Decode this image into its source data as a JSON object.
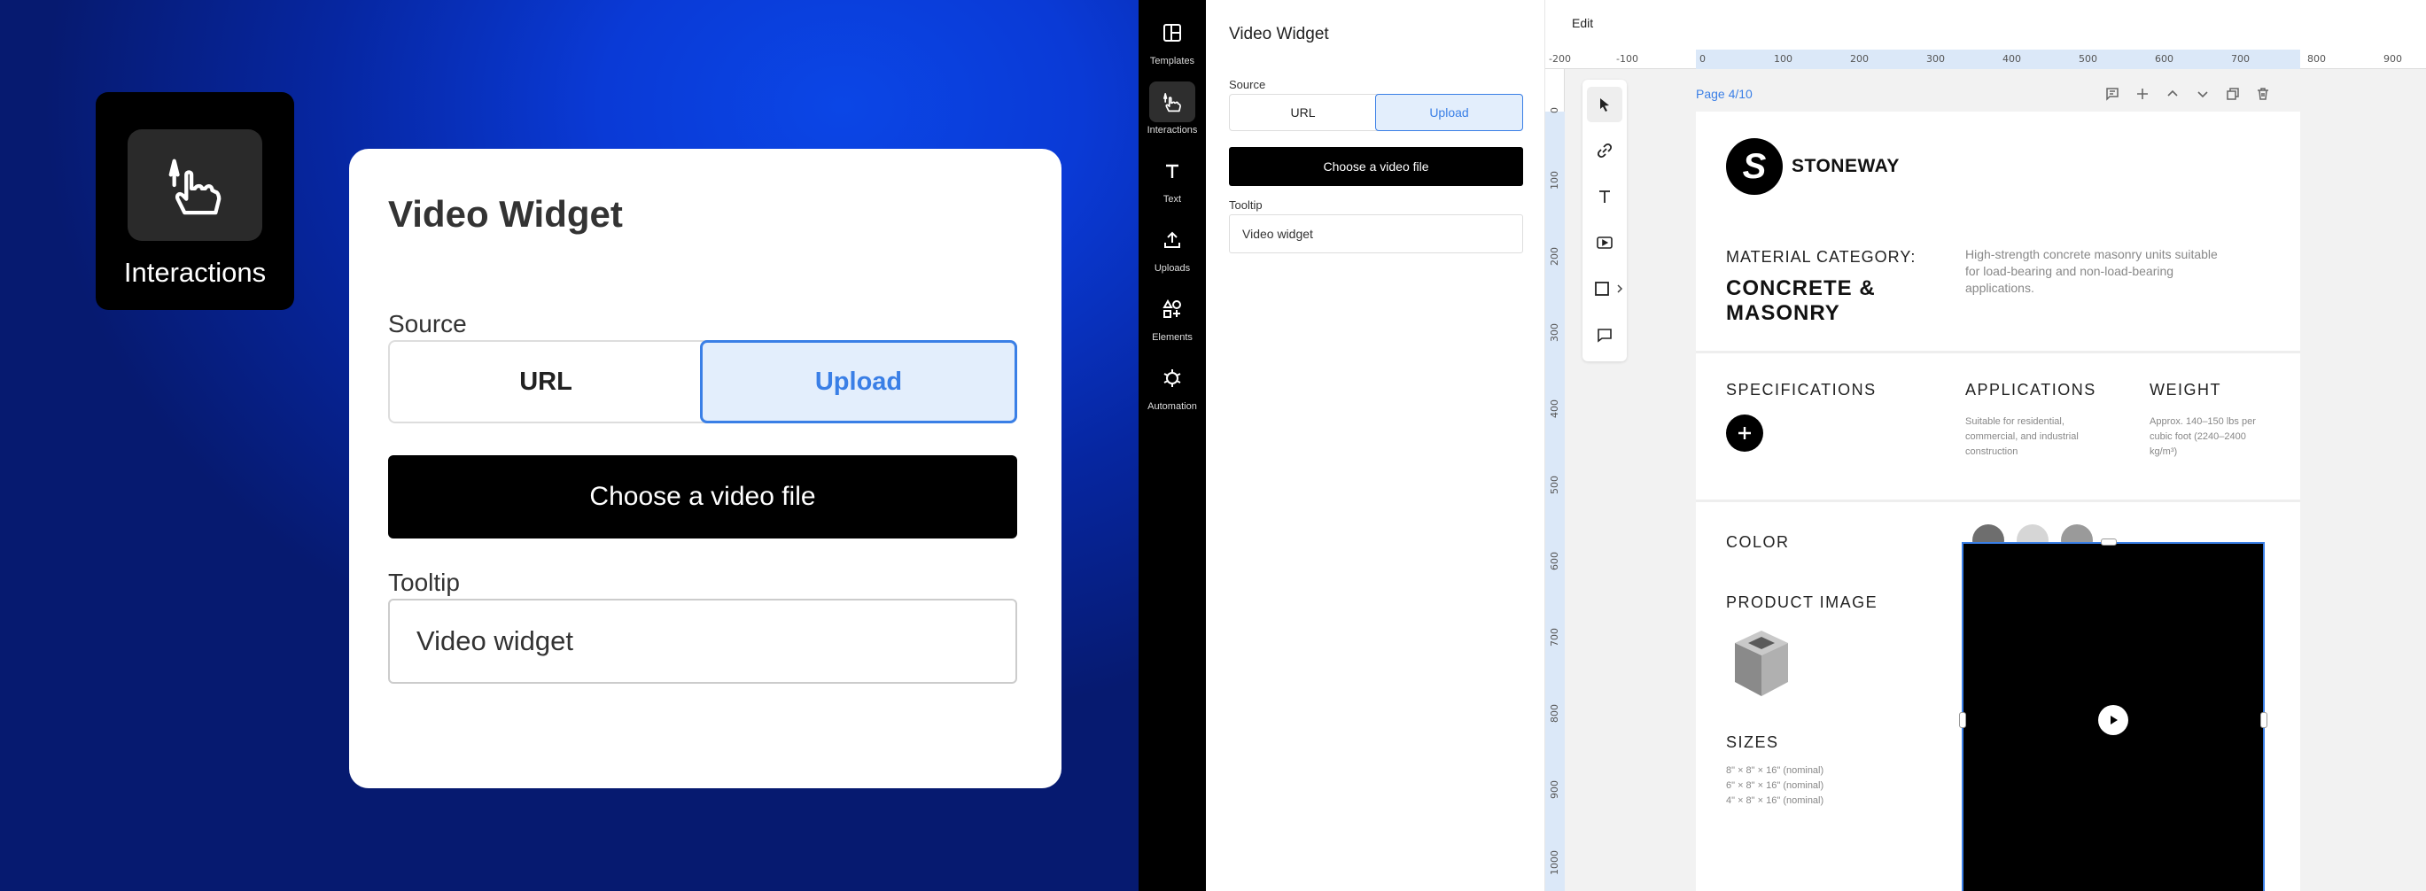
{
  "promo": {
    "badge_label": "Interactions",
    "card": {
      "title": "Video Widget",
      "source_label": "Source",
      "source_options": [
        "URL",
        "Upload"
      ],
      "source_selected": "Upload",
      "choose_button": "Choose a video file",
      "tooltip_label": "Tooltip",
      "tooltip_value": "Video widget"
    }
  },
  "sidebar": {
    "items": [
      {
        "label": "Templates",
        "icon": "templates-icon"
      },
      {
        "label": "Interactions",
        "icon": "interactions-icon",
        "active": true
      },
      {
        "label": "Text",
        "icon": "text-icon"
      },
      {
        "label": "Uploads",
        "icon": "upload-icon"
      },
      {
        "label": "Elements",
        "icon": "elements-icon"
      },
      {
        "label": "Automation",
        "icon": "automation-icon"
      }
    ]
  },
  "props": {
    "title": "Video Widget",
    "source_label": "Source",
    "source_options": [
      "URL",
      "Upload"
    ],
    "source_selected": "Upload",
    "choose_button": "Choose a video file",
    "tooltip_label": "Tooltip",
    "tooltip_value": "Video widget"
  },
  "canvas": {
    "topbar_edit": "Edit",
    "ruler_h": [
      "-200",
      "-100",
      "0",
      "100",
      "200",
      "300",
      "400",
      "500",
      "600",
      "700",
      "800",
      "900"
    ],
    "ruler_v": [
      "0",
      "100",
      "200",
      "300",
      "400",
      "500",
      "600",
      "700",
      "800",
      "900",
      "1000"
    ],
    "page_label": "Page 4/10",
    "doc": {
      "brand": "STONEWAY",
      "logo_letter": "S",
      "material_category_label": "MATERIAL CATEGORY:",
      "material_name": "CONCRETE & MASONRY",
      "material_desc": "High-strength concrete masonry units suitable for load-bearing and non-load-bearing applications.",
      "specifications_label": "SPECIFICATIONS",
      "applications_label": "APPLICATIONS",
      "applications_text": "Suitable for residential, commercial, and industrial construction",
      "weight_label": "WEIGHT",
      "weight_text": "Approx. 140–150 lbs per cubic foot (2240–2400 kg/m³)",
      "color_label": "COLOR",
      "swatch_colors": [
        "#6e6e6e",
        "#d6d6d6",
        "#9a9a9a"
      ],
      "product_image_label": "PRODUCT IMAGE",
      "sizes_label": "SIZES",
      "sizes": [
        "8\" × 8\" × 16\" (nominal)",
        "6\" × 8\" × 16\" (nominal)",
        "4\" × 8\" × 16\" (nominal)"
      ]
    }
  },
  "colors": {
    "accent": "#3a7fe6",
    "accent_bg": "#e3eefc"
  }
}
